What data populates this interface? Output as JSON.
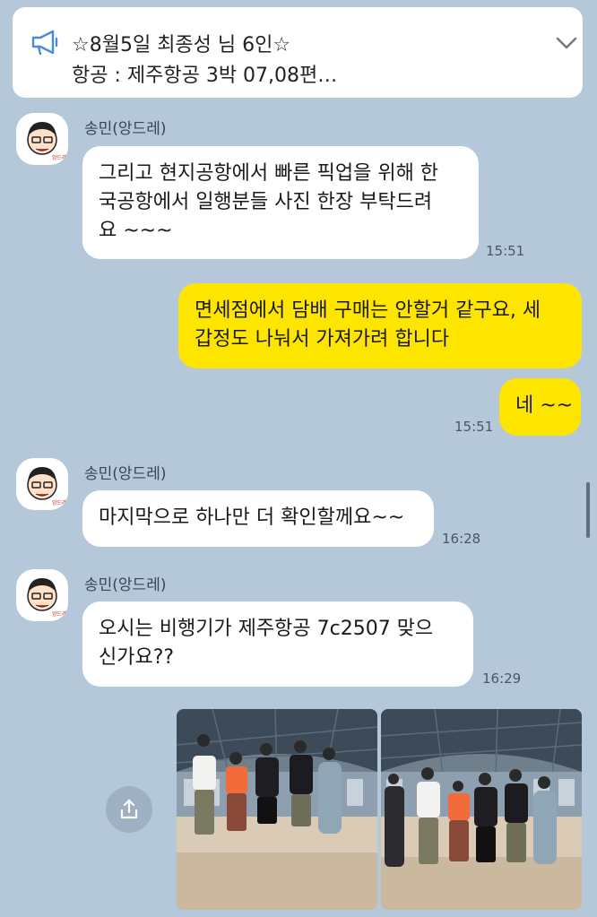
{
  "notice": {
    "line1": "☆8월5일 최종성 님 6인☆",
    "line2": "항공 : 제주항공 3박 07,08편…",
    "icon": "megaphone-icon",
    "toggle_icon": "chevron-down-icon"
  },
  "colors": {
    "background": "#b5c8da",
    "incoming_bubble": "#ffffff",
    "outgoing_bubble": "#fee500"
  },
  "messages": [
    {
      "sender": "송민(앙드레)",
      "line1": "그리고 현지공항에서 빠른 픽업을 위해 한",
      "line2": "국공항에서 일행분들 사진 한장 부탁드려",
      "line3": "요 ~~~",
      "time": "15:51"
    },
    {
      "line1": "면세점에서 담배 구매는 안할거 같구요, 세",
      "line2": "갑정도 나눠서 가져가려 합니다"
    },
    {
      "text": "네 ~~",
      "time": "15:51"
    },
    {
      "sender": "송민(앙드레)",
      "text": "마지막으로 하나만 더 확인할께요~~",
      "time": "16:28"
    },
    {
      "sender": "송민(앙드레)",
      "line1": "오시는 비행기가 제주항공 7c2507 맞으",
      "line2": "신가요??",
      "time": "16:29"
    }
  ],
  "share_icon": "share-icon"
}
